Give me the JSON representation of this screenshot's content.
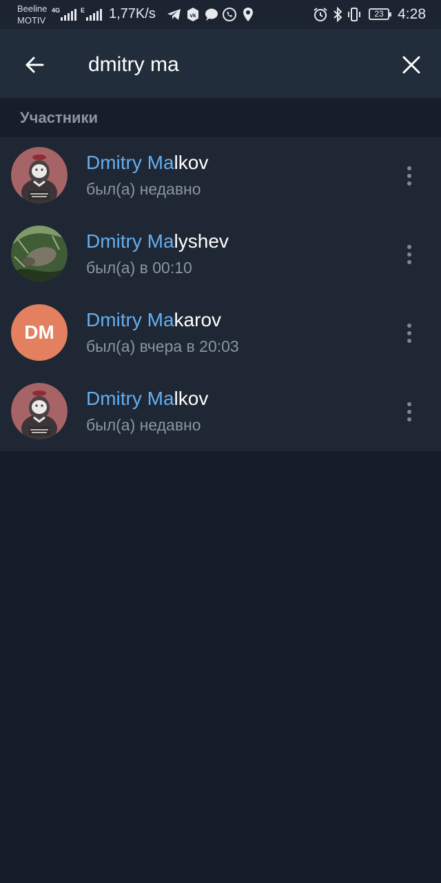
{
  "status_bar": {
    "carrier_top": "Beeline",
    "carrier_bottom": "MOTIV",
    "net1": "4G",
    "net2": "E",
    "speed": "1,77K/s",
    "battery": "23",
    "time": "4:28",
    "icons": [
      "telegram-icon",
      "vk-icon",
      "chat-bubble-icon",
      "whatsapp-icon",
      "location-icon",
      "alarm-icon",
      "bluetooth-icon",
      "vibrate-icon",
      "battery-icon"
    ]
  },
  "search": {
    "query": "dmitry ma"
  },
  "section": {
    "title": "Участники"
  },
  "results": [
    {
      "highlight": "Dmitry Ma",
      "rest": "lkov",
      "status": "был(а) недавно",
      "avatar": "sticker"
    },
    {
      "highlight": "Dmitry Ma",
      "rest": "lyshev",
      "status": "был(а) в 00:10",
      "avatar": "photo"
    },
    {
      "highlight": "Dmitry Ma",
      "rest": "karov",
      "status": "был(а) вчера в 20:03",
      "avatar": "initials",
      "initials": "DM",
      "avatar_color": "#e2805f"
    },
    {
      "highlight": "Dmitry Ma",
      "rest": "lkov",
      "status": "был(а) недавно",
      "avatar": "sticker"
    }
  ],
  "colors": {
    "highlight": "#65aef0",
    "header_bg": "#212d3b",
    "list_bg": "#1e2733",
    "page_bg": "#171d28"
  }
}
